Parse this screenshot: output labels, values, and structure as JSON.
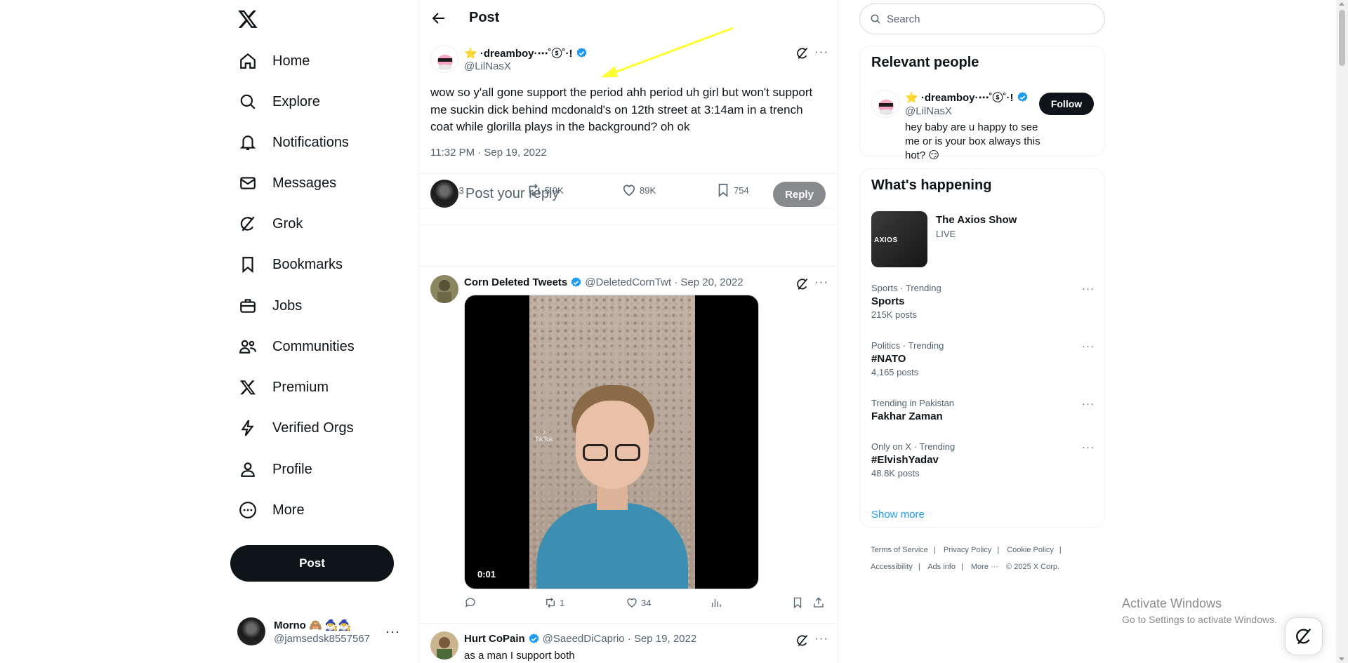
{
  "nav": {
    "items": [
      {
        "label": "Home",
        "icon": "home-icon"
      },
      {
        "label": "Explore",
        "icon": "search-icon"
      },
      {
        "label": "Notifications",
        "icon": "bell-icon"
      },
      {
        "label": "Messages",
        "icon": "mail-icon"
      },
      {
        "label": "Grok",
        "icon": "grok-icon"
      },
      {
        "label": "Bookmarks",
        "icon": "bookmark-icon"
      },
      {
        "label": "Jobs",
        "icon": "briefcase-icon"
      },
      {
        "label": "Communities",
        "icon": "people-icon"
      },
      {
        "label": "Premium",
        "icon": "x-logo-icon"
      },
      {
        "label": "Verified Orgs",
        "icon": "lightning-icon"
      },
      {
        "label": "Profile",
        "icon": "person-icon"
      },
      {
        "label": "More",
        "icon": "more-circle-icon"
      }
    ],
    "post_label": "Post"
  },
  "account": {
    "name": "Morno 🙈 🧙‍♂️🧙‍♂️",
    "handle": "@jamsedsk8557567"
  },
  "header": {
    "title": "Post"
  },
  "tweet": {
    "name": "⭐ ·dreamboy·⋯˚ⓢ˚·!",
    "handle": "@LilNasX",
    "text": "wow so y'all gone support the period ahh period uh girl but won't support me suckin dick behind mcdonald's on 12th street at 3:14am in a trench coat while glorilla plays in the background? oh ok",
    "time": "11:32 PM · Sep 19, 2022",
    "stats": {
      "replies": "513",
      "reposts": "5.9K",
      "likes": "89K",
      "bookmarks": "754"
    }
  },
  "reply_box": {
    "placeholder": "Post your reply",
    "button": "Reply"
  },
  "replies": [
    {
      "name": "Corn Deleted Tweets",
      "meta": "@DeletedCornTwt · Sep 20, 2022",
      "video_time": "0:01",
      "tiktok": "TikTok",
      "stats": {
        "replies": "",
        "reposts": "1",
        "likes": "34"
      }
    },
    {
      "name": "Hurt CoPain",
      "meta": "@SaeedDiCaprio · Sep 19, 2022",
      "text": "as a man I support both"
    }
  ],
  "search": {
    "placeholder": "Search"
  },
  "relevant": {
    "title": "Relevant people",
    "name": "⭐ ·dreamboy·⋯˚ⓢ˚·!",
    "handle": "@LilNasX",
    "bio": "hey baby are u happy to see me or is your box always this hot? 😏",
    "follow": "Follow"
  },
  "happening": {
    "title": "What's happening",
    "live": {
      "title": "The Axios Show",
      "badge": "LIVE",
      "thumb_text": "AXIOS"
    },
    "trends": [
      {
        "category": "Sports · Trending",
        "name": "Sports",
        "count": "215K posts"
      },
      {
        "category": "Politics · Trending",
        "name": "#NATO",
        "count": "4,165 posts"
      },
      {
        "category": "Trending in Pakistan",
        "name": "Fakhar Zaman",
        "count": ""
      },
      {
        "category": "Only on X · Trending",
        "name": "#ElvishYadav",
        "count": "48.8K posts"
      }
    ],
    "show_more": "Show more"
  },
  "footer": {
    "links": [
      "Terms of Service",
      "|",
      "Privacy Policy",
      "|",
      "Cookie Policy",
      "|",
      "Accessibility",
      "|",
      "Ads info",
      "|",
      "More ···",
      "© 2025 X Corp."
    ]
  },
  "windows": {
    "title": "Activate Windows",
    "subtitle": "Go to Settings to activate Windows."
  },
  "colors": {
    "accent": "#1d9bf0",
    "text": "#0f1419",
    "muted": "#536471",
    "annotation_arrow": "#ffff33"
  }
}
